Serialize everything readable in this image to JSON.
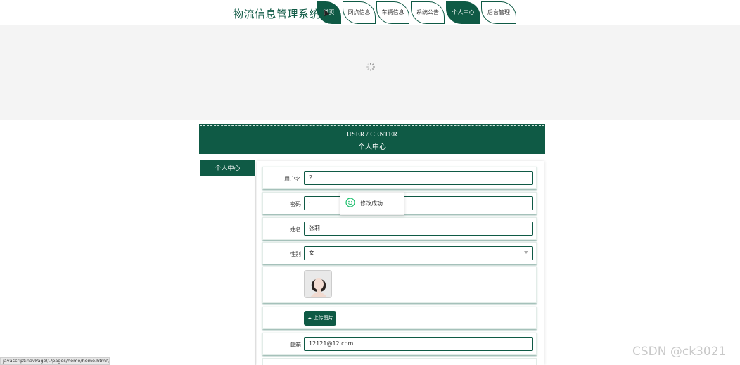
{
  "brand": "物流信息管理系统",
  "nav": {
    "tabs": [
      {
        "label": "首页",
        "active": true
      },
      {
        "label": "网点信息",
        "active": false
      },
      {
        "label": "车辆信息",
        "active": false
      },
      {
        "label": "系统公告",
        "active": false
      },
      {
        "label": "个人中心",
        "active": true
      },
      {
        "label": "后台管理",
        "active": false
      }
    ]
  },
  "section": {
    "title_en": "USER / CENTER",
    "title_cn": "个人中心"
  },
  "side_menu": {
    "title": "个人中心"
  },
  "form": {
    "username_label": "用户名",
    "username_value": "2",
    "password_label": "密码",
    "password_value": "·",
    "name_label": "姓名",
    "name_value": "张莉",
    "gender_label": "性别",
    "gender_value": "女",
    "upload_label": "上传图片",
    "email_label": "邮箱",
    "email_value": "12121@12.com"
  },
  "toast": {
    "message": "修改成功"
  },
  "statusbar": "javascript:navPage('./pages/home/home.html')",
  "watermark": "CSDN @ck3021",
  "colors": {
    "primary": "#0f5a45",
    "banner_bg": "#f4f4f4"
  }
}
